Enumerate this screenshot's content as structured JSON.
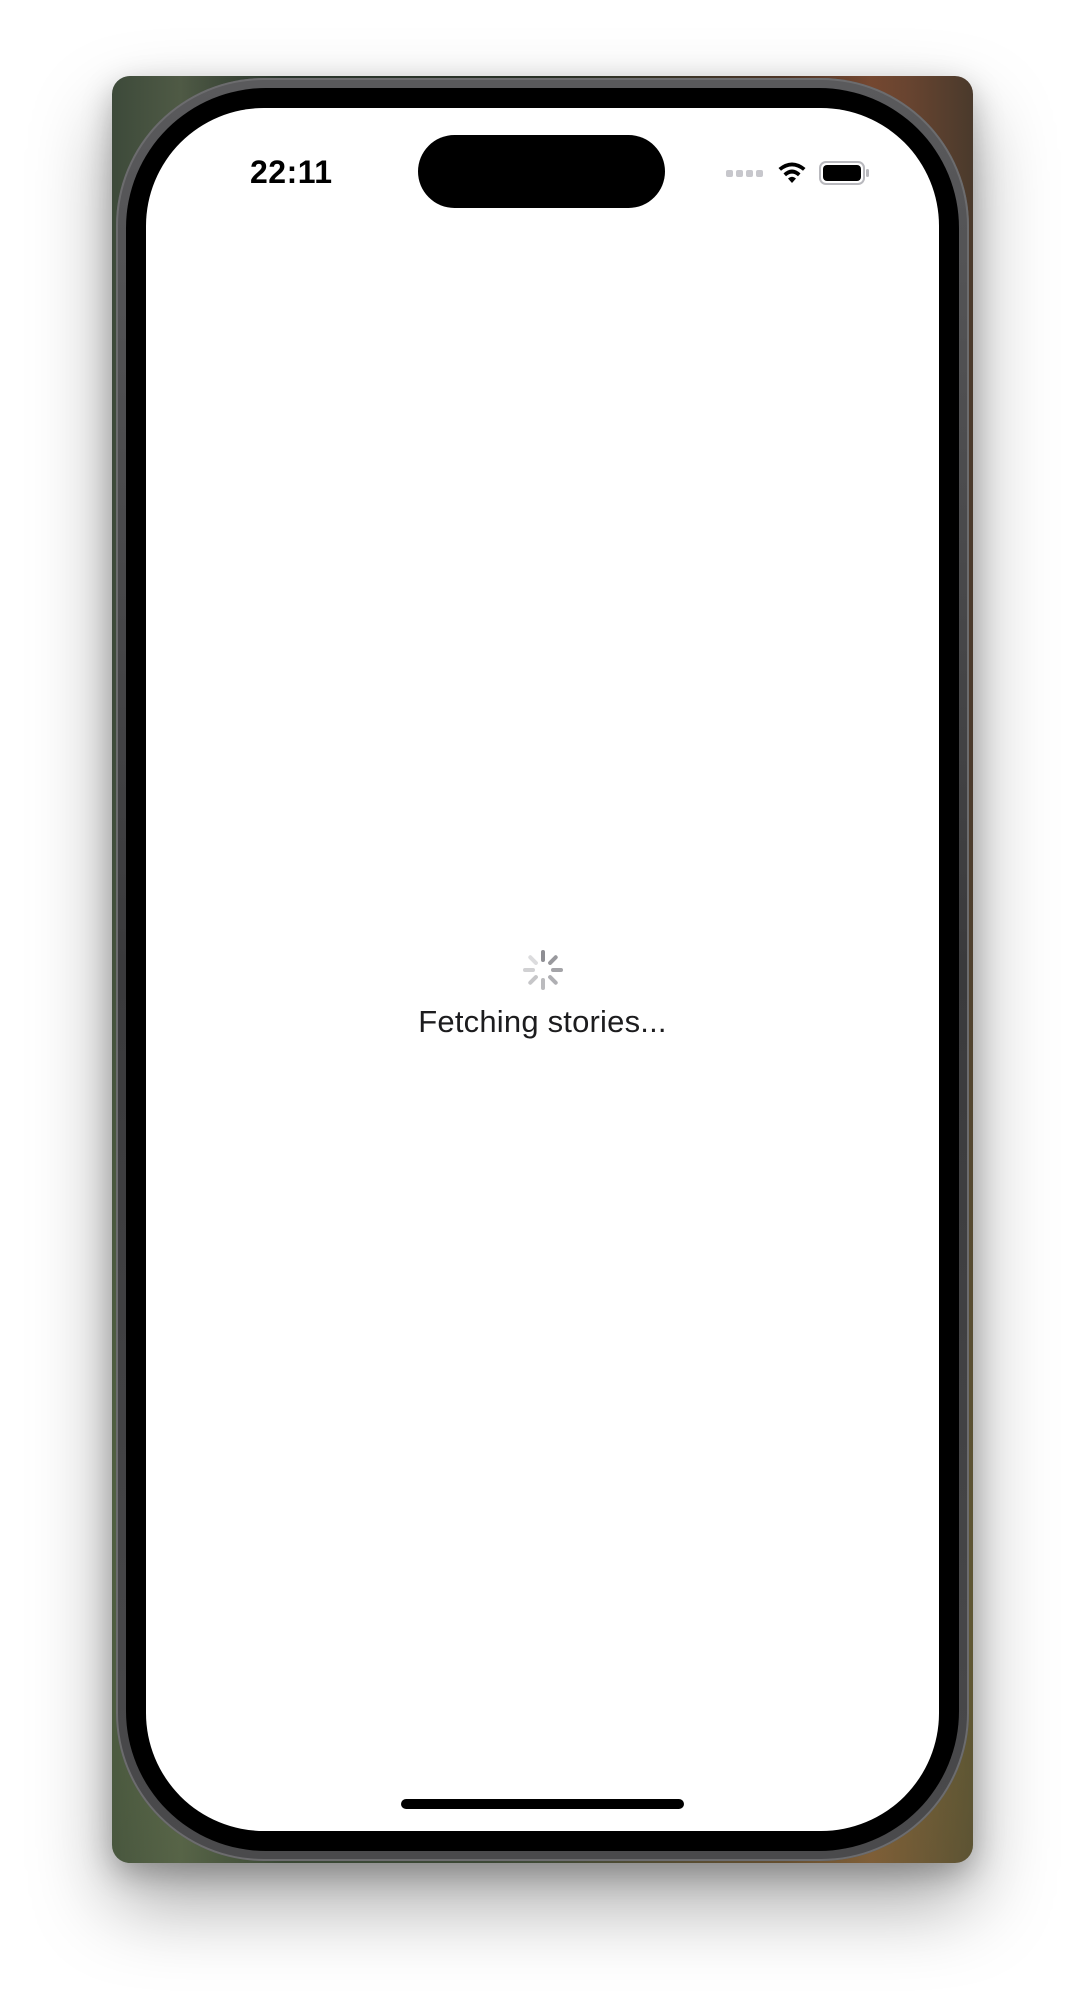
{
  "status_bar": {
    "time": "22:11",
    "icons": [
      "cellular-signal-icon",
      "wifi-icon",
      "battery-icon"
    ]
  },
  "loading": {
    "label": "Fetching stories...",
    "icon": "activity-spinner-icon"
  },
  "colors": {
    "screen_background": "#ffffff",
    "text": "#1c1c1e",
    "spinner": "#8e8e93"
  }
}
